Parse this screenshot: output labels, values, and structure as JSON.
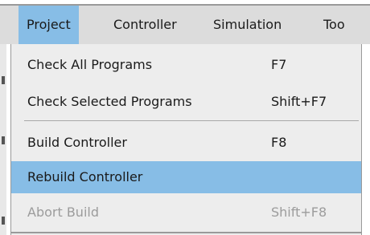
{
  "menubar": {
    "items": [
      {
        "label": "Project"
      },
      {
        "label": "Controller"
      },
      {
        "label": "Simulation"
      },
      {
        "label": "Too"
      }
    ]
  },
  "dropdown": {
    "items": [
      {
        "label": "Check All Programs",
        "shortcut": "F7"
      },
      {
        "label": "Check Selected Programs",
        "shortcut": "Shift+F7"
      },
      {
        "label": "Build Controller",
        "shortcut": "F8"
      },
      {
        "label": "Rebuild Controller",
        "shortcut": ""
      },
      {
        "label": "Abort Build",
        "shortcut": "Shift+F8",
        "disabled": true
      }
    ]
  },
  "colors": {
    "highlight": "#87bde6",
    "menubar_bg": "#dcdcdc",
    "dropdown_bg": "#ededed",
    "disabled_text": "#9c9c9c"
  }
}
